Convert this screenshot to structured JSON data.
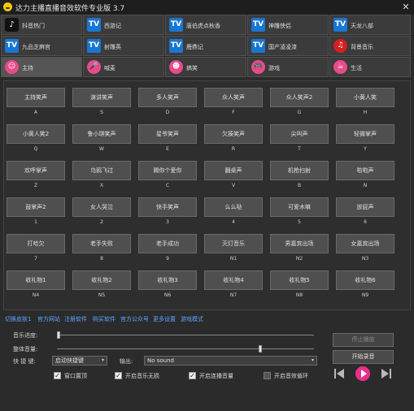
{
  "window": {
    "title": "达力主播直播音效软件专业版 3.7",
    "close_glyph": "✕"
  },
  "categories": [
    {
      "label": "抖音热门",
      "icon": "tiktok-icon",
      "glyph": "♪"
    },
    {
      "label": "西游记",
      "icon": "tv-icon",
      "glyph": "TV"
    },
    {
      "label": "唐伯虎点秋香",
      "icon": "tv-icon",
      "glyph": "TV"
    },
    {
      "label": "神雕侠侣",
      "icon": "tv-icon",
      "glyph": "TV"
    },
    {
      "label": "天龙八部",
      "icon": "tv-icon",
      "glyph": "TV"
    },
    {
      "label": "九品芝麻官",
      "icon": "tv-icon",
      "glyph": "TV"
    },
    {
      "label": "射雕英",
      "icon": "tv-icon",
      "glyph": "TV"
    },
    {
      "label": "鹿鼎记",
      "icon": "tv-icon",
      "glyph": "TV"
    },
    {
      "label": "国产凌凌漆",
      "icon": "tv-icon",
      "glyph": "TV"
    },
    {
      "label": "背景音乐",
      "icon": "music-icon",
      "glyph": "♫"
    },
    {
      "label": "主持",
      "icon": "host-icon",
      "glyph": "☺"
    },
    {
      "label": "喊麦",
      "icon": "microphone-icon",
      "glyph": "🎤"
    },
    {
      "label": "搞笑",
      "icon": "laugh-icon",
      "glyph": "☻"
    },
    {
      "label": "游戏",
      "icon": "gamepad-icon",
      "glyph": "🎮"
    },
    {
      "label": "生活",
      "icon": "life-icon",
      "glyph": "☕"
    }
  ],
  "active_category": "主持",
  "sounds": [
    {
      "label": "主持笑声",
      "key": "A"
    },
    {
      "label": "演讲笑声",
      "key": "S"
    },
    {
      "label": "多人笑声",
      "key": "D"
    },
    {
      "label": "众人笑声",
      "key": "F"
    },
    {
      "label": "众人笑声2",
      "key": "G"
    },
    {
      "label": "小黄人笑",
      "key": "H"
    },
    {
      "label": "小黄人笑2",
      "key": "Q"
    },
    {
      "label": "鲁小琪笑声",
      "key": "W"
    },
    {
      "label": "星爷笑声",
      "key": "E"
    },
    {
      "label": "欠揍笑声",
      "key": "R"
    },
    {
      "label": "尖叫声",
      "key": "T"
    },
    {
      "label": "轻微掌声",
      "key": "Y"
    },
    {
      "label": "欢呼掌声",
      "key": "Z"
    },
    {
      "label": "乌鸦飞过",
      "key": "X"
    },
    {
      "label": "赐你个爱你",
      "key": "C"
    },
    {
      "label": "翻桌声",
      "key": "V"
    },
    {
      "label": "机枪扫射",
      "key": "B"
    },
    {
      "label": "啦啦声",
      "key": "N"
    },
    {
      "label": "鼓掌声2",
      "key": "1"
    },
    {
      "label": "女人哭泣",
      "key": "2"
    },
    {
      "label": "快手笑声",
      "key": "3"
    },
    {
      "label": "么么哒",
      "key": "4"
    },
    {
      "label": "可爱木嘛",
      "key": "5"
    },
    {
      "label": "放屁声",
      "key": "6"
    },
    {
      "label": "打哈欠",
      "key": "7"
    },
    {
      "label": "老手失败",
      "key": "8"
    },
    {
      "label": "老手成功",
      "key": "9"
    },
    {
      "label": "灭灯音乐",
      "key": "N1"
    },
    {
      "label": "男嘉宾出场",
      "key": "N2"
    },
    {
      "label": "女嘉宾出场",
      "key": "N3"
    },
    {
      "label": "收礼物1",
      "key": "N4"
    },
    {
      "label": "收礼物2",
      "key": "N5"
    },
    {
      "label": "收礼物3",
      "key": "N6"
    },
    {
      "label": "收礼物4",
      "key": "N7"
    },
    {
      "label": "收礼物5",
      "key": "N8"
    },
    {
      "label": "收礼物6",
      "key": "N9"
    }
  ],
  "links": [
    "切换皮肤1",
    "官方网站",
    "注册软件",
    "购买软件",
    "官方公众号",
    "更多设置",
    "游戏模式"
  ],
  "controls": {
    "progress_label": "音乐进度:",
    "volume_label": "整体音量:",
    "volume_level": 0.79,
    "hotkey_label": "快 捷 键:",
    "hotkey_value": "启动快捷键",
    "output_label": "输出:",
    "output_value": "No sound",
    "checkboxes": [
      {
        "label": "窗口置顶",
        "checked": true
      },
      {
        "label": "开启音乐无损",
        "checked": true
      },
      {
        "label": "开启连播音量",
        "checked": true
      },
      {
        "label": "开启音效循环",
        "checked": false
      }
    ],
    "stop_label": "停止播放",
    "start_label": "开始录音",
    "check_glyph": "✓",
    "arrow_glyph": "▾"
  },
  "colors": {
    "background": "#2b2b2b",
    "link": "#59a6ff",
    "tv_icon": "#1976d2",
    "media_pink": "#e8308a"
  }
}
